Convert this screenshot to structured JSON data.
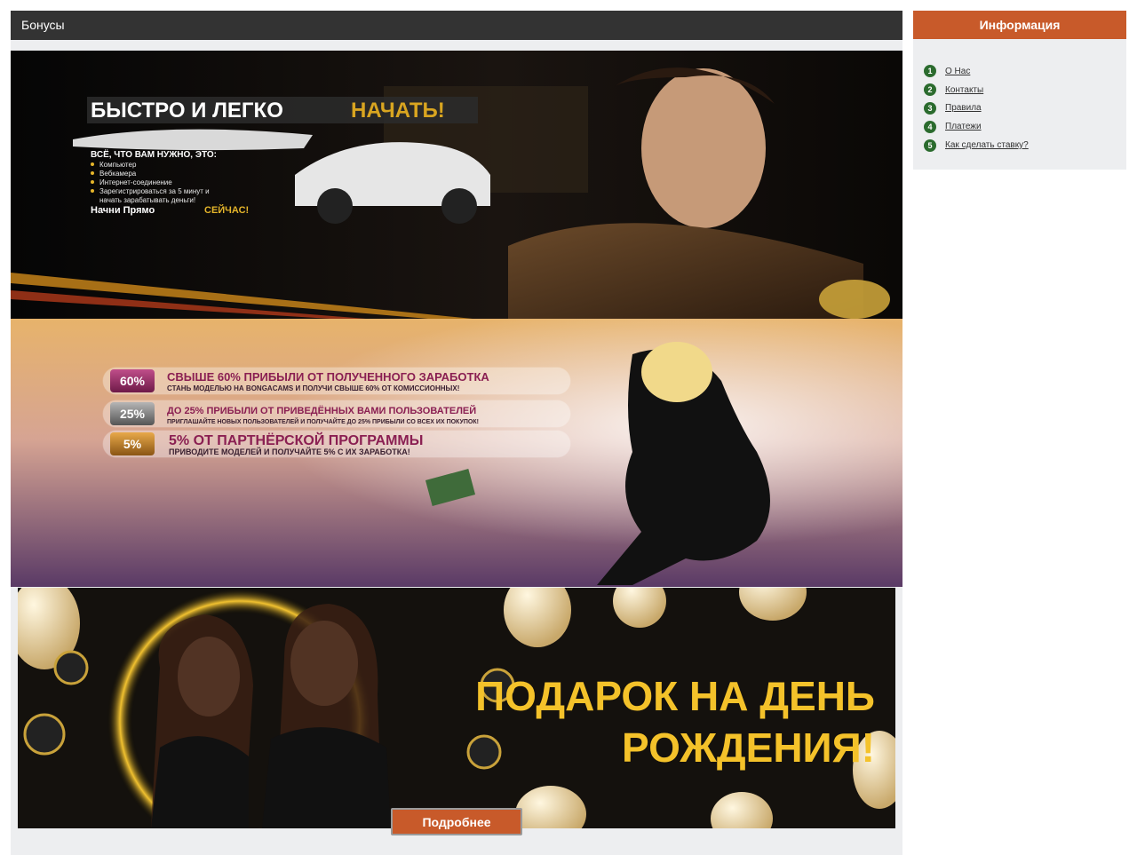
{
  "section": {
    "title": "Бонусы"
  },
  "banner1": {
    "headline_a": "БЫСТРО И ЛЕГКО",
    "headline_b": "НАЧАТЬ!",
    "subheading": "ВСЁ, ЧТО ВАМ НУЖНО, ЭТО:",
    "list": [
      "Компьютер",
      "Вебкамера",
      "Интернет-соединение",
      "Зарегистрироваться за 5 минут и",
      "начать зарабатывать деньги!"
    ],
    "cta_a": "Начни Прямо",
    "cta_b": "СЕЙЧАС!"
  },
  "banner2": {
    "rows": [
      {
        "badge": "60%",
        "title": "СВЫШЕ 60% ПРИБЫЛИ ОТ ПОЛУЧЕННОГО ЗАРАБОТКА",
        "subtitle": "СТАНЬ МОДЕЛЬЮ НА BONGACAMS И ПОЛУЧИ СВЫШЕ 60% ОТ КОМИССИОННЫХ!"
      },
      {
        "badge": "25%",
        "title": "ДО 25% ПРИБЫЛИ ОТ ПРИВЕДЁННЫХ ВАМИ ПОЛЬЗОВАТЕЛЕЙ",
        "subtitle": "ПРИГЛАШАЙТЕ НОВЫХ ПОЛЬЗОВАТЕЛЕЙ И ПОЛУЧАЙТЕ ДО 25% ПРИБЫЛИ СО ВСЕХ ИХ ПОКУПОК!"
      },
      {
        "badge": "5%",
        "title": "5% ОТ ПАРТНЁРСКОЙ ПРОГРАММЫ",
        "subtitle": "ПРИВОДИТЕ МОДЕЛЕЙ И ПОЛУЧАЙТЕ 5% С ИХ ЗАРАБОТКА!"
      }
    ]
  },
  "banner3": {
    "line1": "ПОДАРОК НА ДЕНЬ",
    "line2": "РОЖДЕНИЯ!"
  },
  "more_button": {
    "label": "Подробнее"
  },
  "sidebar": {
    "title": "Информация",
    "items": [
      {
        "num": "1",
        "label": "О Нас"
      },
      {
        "num": "2",
        "label": "Контакты"
      },
      {
        "num": "3",
        "label": "Правила"
      },
      {
        "num": "4",
        "label": "Платежи"
      },
      {
        "num": "5",
        "label": "Как сделать ставку?"
      }
    ]
  },
  "colors": {
    "accent": "#c85a2a",
    "header_bg": "#333333",
    "badge_green": "#2b6b2e",
    "panel_bg": "#edeef0"
  }
}
